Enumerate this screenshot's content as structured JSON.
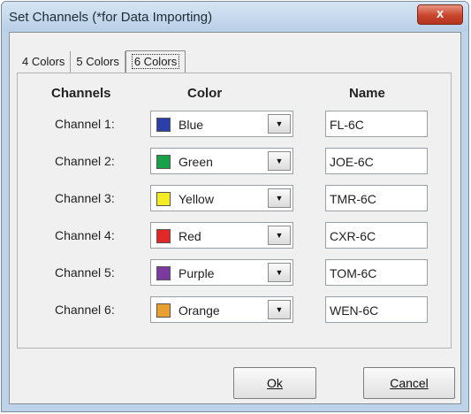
{
  "window": {
    "title": "Set Channels (*for  Data Importing)",
    "close_glyph": "x"
  },
  "tabs": [
    {
      "label": "4 Colors",
      "active": false
    },
    {
      "label": "5 Colors",
      "active": false
    },
    {
      "label": "6 Colors",
      "active": true
    }
  ],
  "headers": {
    "channels": "Channels",
    "color": "Color",
    "name": "Name"
  },
  "channels": [
    {
      "label": "Channel 1:",
      "color": "Blue",
      "swatch": "#2b3fa8",
      "name": "FL-6C"
    },
    {
      "label": "Channel 2:",
      "color": "Green",
      "swatch": "#19a14a",
      "name": "JOE-6C"
    },
    {
      "label": "Channel 3:",
      "color": "Yellow",
      "swatch": "#f4ec26",
      "name": "TMR-6C"
    },
    {
      "label": "Channel 4:",
      "color": "Red",
      "swatch": "#e02828",
      "name": "CXR-6C"
    },
    {
      "label": "Channel 5:",
      "color": "Purple",
      "swatch": "#7a3aa0",
      "name": "TOM-6C"
    },
    {
      "label": "Channel 6:",
      "color": "Orange",
      "swatch": "#e8a030",
      "name": "WEN-6C"
    }
  ],
  "dropdown_glyph": "▼",
  "buttons": {
    "ok": "Ok",
    "cancel": "Cancel"
  }
}
